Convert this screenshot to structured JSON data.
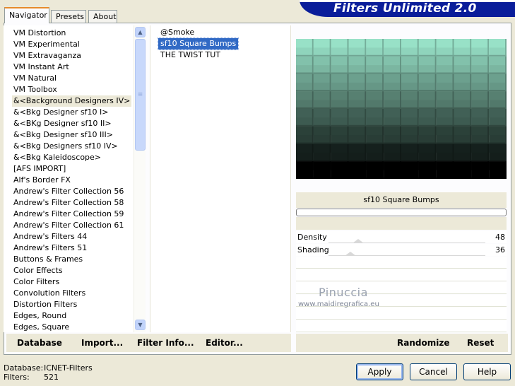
{
  "app": {
    "title": "Filters Unlimited 2.0"
  },
  "tabs": [
    {
      "label": "Navigator",
      "active": true
    },
    {
      "label": "Presets",
      "active": false
    },
    {
      "label": "About",
      "active": false
    }
  ],
  "categories": {
    "items": [
      "VM Distortion",
      "VM Experimental",
      "VM Extravaganza",
      "VM Instant Art",
      "VM Natural",
      "VM Toolbox",
      "&<Background Designers IV>",
      "&<Bkg Designer sf10 I>",
      "&<BKg Designer sf10 II>",
      "&<Bkg Designer sf10 III>",
      "&<Bkg Designers sf10 IV>",
      "&<Bkg Kaleidoscope>",
      "[AFS IMPORT]",
      "Alf's Border FX",
      "Andrew's Filter Collection 56",
      "Andrew's Filter Collection 58",
      "Andrew's Filter Collection 59",
      "Andrew's Filter Collection 61",
      "Andrew's Filters 44",
      "Andrew's Filters 51",
      "Buttons & Frames",
      "Color Effects",
      "Color Filters",
      "Convolution Filters",
      "Distortion Filters",
      "Edges, Round",
      "Edges, Square"
    ],
    "selected_index": 6
  },
  "filters": {
    "items": [
      "@Smoke",
      "sf10 Square Bumps",
      "THE TWIST TUT"
    ],
    "selected_index": 1
  },
  "preview": {
    "filter_name": "sf10 Square Bumps",
    "top_color": "#8fd4bc",
    "bottom_color": "#000000",
    "progress": 0
  },
  "params": [
    {
      "label": "Density",
      "value": "48",
      "level": 0.19
    },
    {
      "label": "Shading",
      "value": "36",
      "level": 0.14
    }
  ],
  "watermark": {
    "name": "Pinuccia",
    "url": "www.maidiregrafica.eu"
  },
  "bottom_buttons": {
    "database": "Database",
    "import": "Import...",
    "filter_info": "Filter Info...",
    "editor": "Editor...",
    "randomize": "Randomize",
    "reset": "Reset"
  },
  "status": {
    "database_label": "Database:",
    "database_value": "ICNET-Filters",
    "filters_label": "Filters:",
    "filters_value": "521"
  },
  "dialog_buttons": {
    "apply": "Apply",
    "cancel": "Cancel",
    "help": "Help"
  }
}
